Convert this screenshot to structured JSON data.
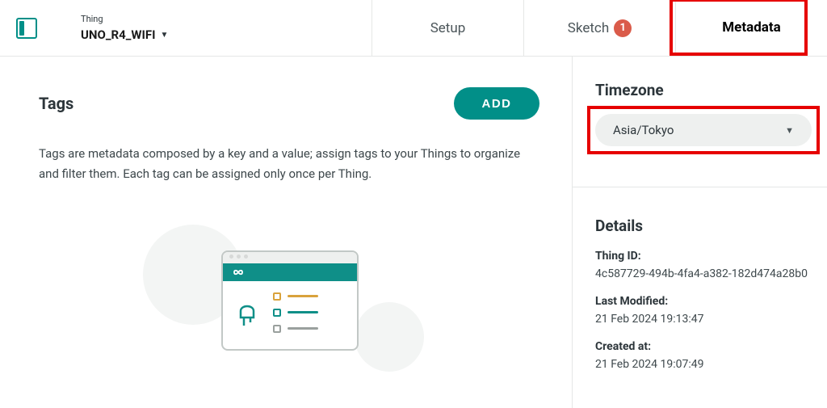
{
  "header": {
    "thing_label": "Thing",
    "thing_name": "UNO_R4_WIFI"
  },
  "tabs": {
    "setup": "Setup",
    "sketch": "Sketch",
    "sketch_badge": "1",
    "metadata": "Metadata"
  },
  "tags": {
    "heading": "Tags",
    "add_button": "ADD",
    "description": "Tags are metadata composed by a key and a value; assign tags to your Things to organize and filter them. Each tag can be assigned only once per Thing."
  },
  "timezone": {
    "heading": "Timezone",
    "selected": "Asia/Tokyo"
  },
  "details": {
    "heading": "Details",
    "thing_id_label": "Thing ID:",
    "thing_id": "4c587729-494b-4fa4-a382-182d474a28b0",
    "last_modified_label": "Last Modified:",
    "last_modified": "21 Feb 2024 19:13:47",
    "created_at_label": "Created at:",
    "created_at": "21 Feb 2024 19:07:49"
  }
}
